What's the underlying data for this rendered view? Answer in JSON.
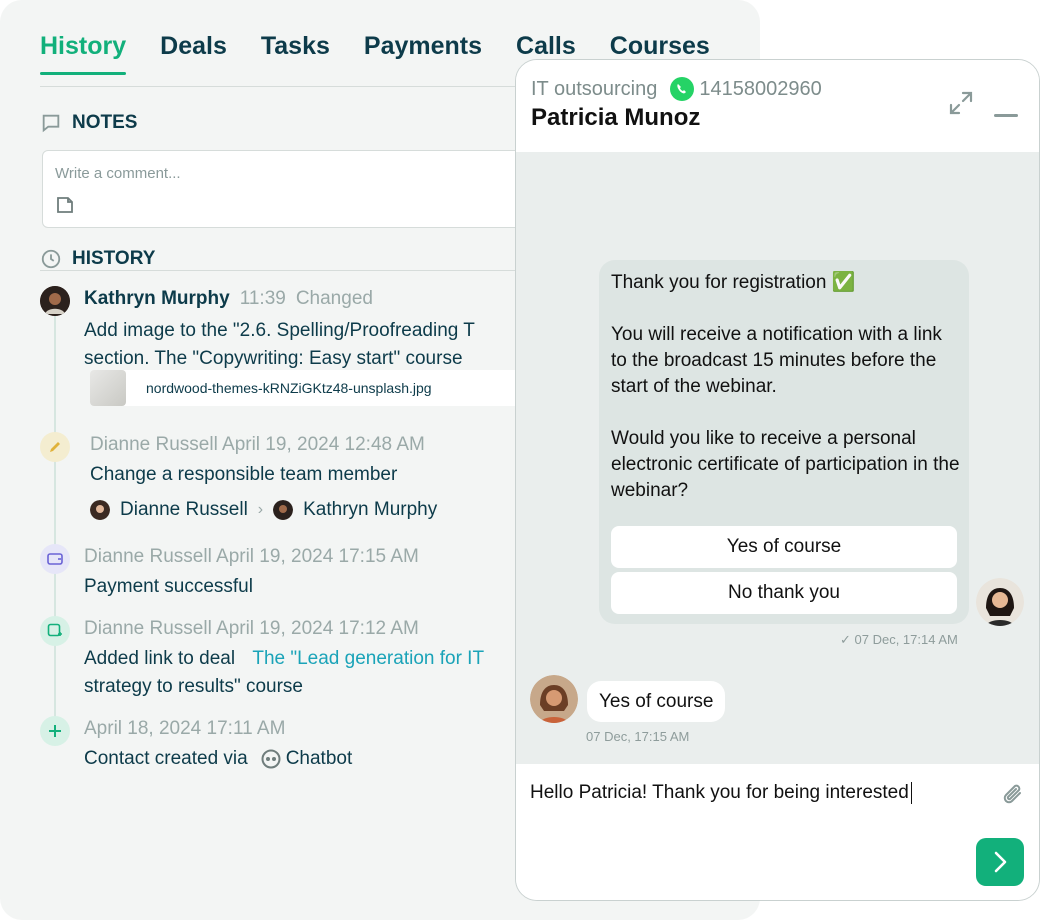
{
  "tabs": [
    "History",
    "Deals",
    "Tasks",
    "Payments",
    "Calls",
    "Courses"
  ],
  "notes": {
    "title": "NOTES",
    "placeholder": "Write a comment..."
  },
  "history": {
    "title": "HISTORY",
    "events": [
      {
        "author": "Kathryn Murphy",
        "time": "11:39",
        "action": "Changed",
        "line1": "Add image to the \"2.6. Spelling/Proofreading T",
        "line2": "section. The \"Copywriting: Easy start\" course",
        "file": "nordwood-themes-kRNZiGKtz48-unsplash.jpg"
      },
      {
        "meta": "Dianne Russell  April 19, 2024 12:48 AM",
        "text": "Change a responsible team member",
        "from": "Dianne Russell",
        "to": "Kathryn Murphy"
      },
      {
        "meta": "Dianne Russell April 19, 2024 17:15 AM",
        "text": "Payment successful"
      },
      {
        "meta": "Dianne Russell April 19, 2024 17:12 AM",
        "text": "Added link to deal",
        "link1": "The \"Lead generation for IT",
        "link2": "strategy to results\" course"
      },
      {
        "meta": "April 18, 2024 17:11 AM",
        "text": "Contact created via",
        "channel": "Chatbot"
      }
    ]
  },
  "chat": {
    "company": "IT outsourcing",
    "phone": "14158002960",
    "contact_name": "Patricia Munoz",
    "outgoing": {
      "line1": "Thank you for registration ✅",
      "line2": "You will receive a notification with a link to the broadcast 15 minutes before the start of the webinar.",
      "line3": "Would you like to receive a personal electronic certificate of participation in the webinar?",
      "buttons": [
        "Yes of course",
        "No thank you"
      ],
      "time": "✓ 07 Dec, 17:14 AM"
    },
    "incoming": {
      "text": "Yes of course",
      "time": "07 Dec, 17:15 AM"
    },
    "composer_text": "Hello Patricia! Thank you for being interested"
  },
  "colors": {
    "accent": "#12b07b",
    "link": "#1aa3b8",
    "text": "#0d3b4a"
  }
}
